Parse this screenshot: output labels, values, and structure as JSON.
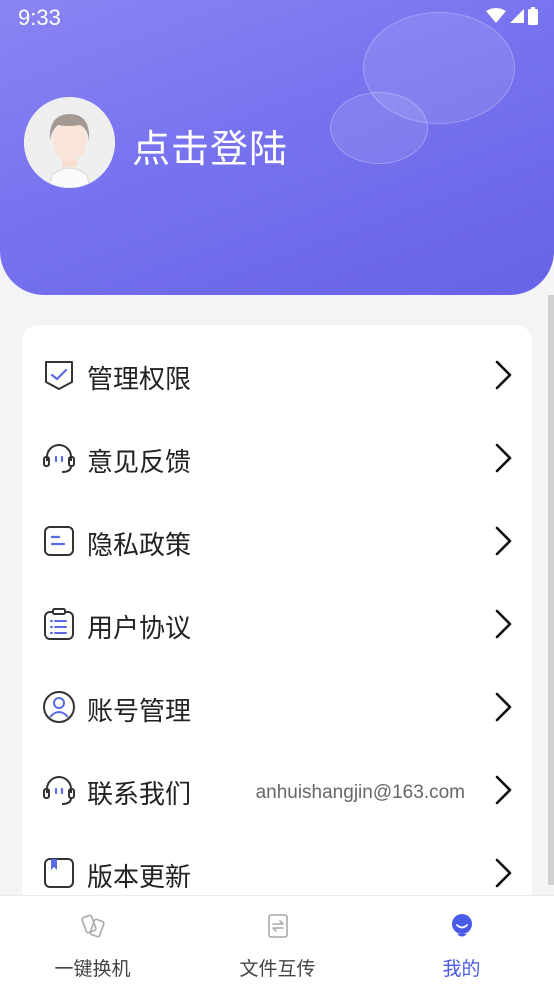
{
  "status_bar": {
    "time": "9:33"
  },
  "header": {
    "login_text": "点击登陆"
  },
  "menu": {
    "items": [
      {
        "label": "管理权限",
        "icon": "shield-check-icon"
      },
      {
        "label": "意见反馈",
        "icon": "headset-icon"
      },
      {
        "label": "隐私政策",
        "icon": "document-icon"
      },
      {
        "label": "用户协议",
        "icon": "clipboard-list-icon"
      },
      {
        "label": "账号管理",
        "icon": "user-circle-icon"
      },
      {
        "label": "联系我们",
        "icon": "headset-icon",
        "extra": "anhuishangjin@163.com"
      },
      {
        "label": "版本更新",
        "icon": "bookmark-icon"
      }
    ]
  },
  "tabbar": {
    "tabs": [
      {
        "label": "一键换机",
        "icon": "phone-swap-icon",
        "active": false
      },
      {
        "label": "文件互传",
        "icon": "file-transfer-icon",
        "active": false
      },
      {
        "label": "我的",
        "icon": "profile-icon",
        "active": true
      }
    ]
  },
  "colors": {
    "accent": "#4a5be8",
    "header_start": "#8a84f3",
    "header_end": "#6663e6"
  }
}
